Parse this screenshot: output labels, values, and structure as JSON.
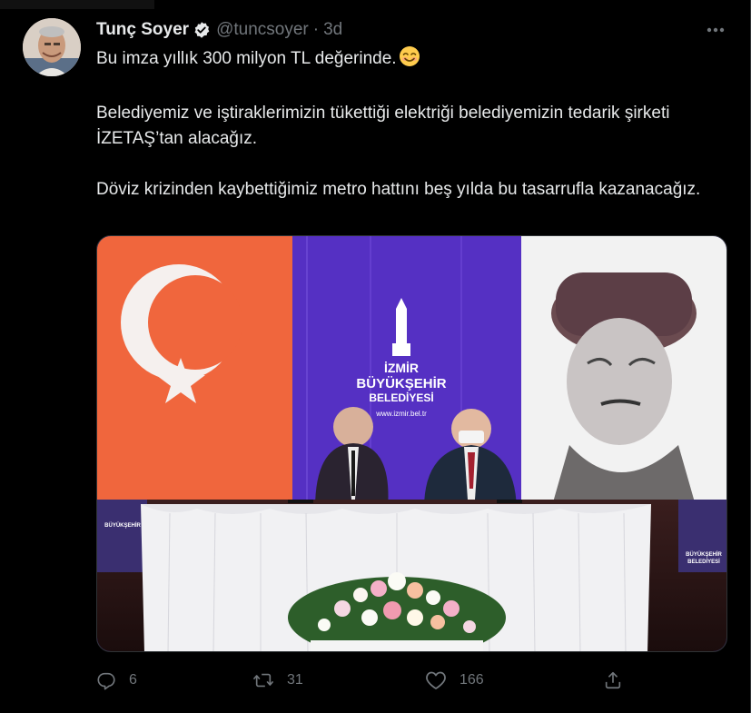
{
  "tweet": {
    "author_name": "Tunç Soyer",
    "handle": "@tuncsoyer",
    "separator": "·",
    "time": "3d",
    "lines": [
      "Bu imza yıllık 300 milyon TL değerinde.",
      "Belediyemiz ve iştiraklerimizin tükettiği elektriği belediyemizin tedarik şirketi İZETAŞ’tan alacağız.",
      "Döviz krizinden kaybettiğimiz metro hattını beş yılda bu tasarrufla kazanacağız."
    ],
    "emoji": "smiling-face-emoji"
  },
  "media": {
    "backdrop_logo_line1": "İZMİR",
    "backdrop_logo_line2": "BÜYÜKŞEHİR",
    "backdrop_logo_line3": "BELEDİYESİ",
    "backdrop_url": "www.izmir.bel.tr",
    "side_banner_line1": "BÜYÜKŞEHİR",
    "side_banner_line2": "BELEDİYESİ"
  },
  "actions": {
    "reply_count": "6",
    "retweet_count": "31",
    "like_count": "166"
  },
  "icons": {
    "verified": "verified-badge-icon",
    "more": "more-horizontal-icon",
    "reply": "reply-icon",
    "retweet": "retweet-icon",
    "like": "heart-icon",
    "share": "share-icon"
  },
  "colors": {
    "background": "#000000",
    "text": "#e7e9ea",
    "muted": "#71767b",
    "flag_red": "#f0663d",
    "stage_purple": "#5a2fc0"
  }
}
